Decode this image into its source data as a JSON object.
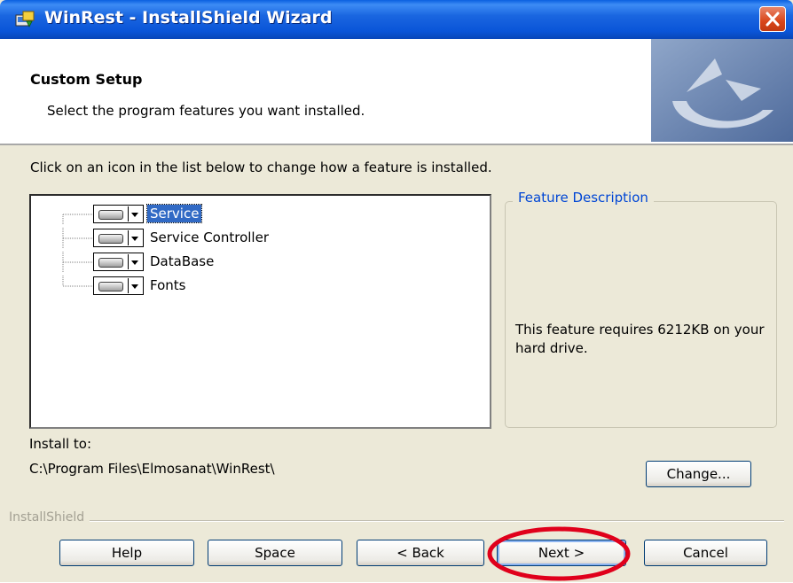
{
  "window": {
    "title": "WinRest - InstallShield Wizard"
  },
  "header": {
    "title": "Custom Setup",
    "subtitle": "Select the program features you want installed."
  },
  "instructions": "Click on an icon in the list below to change how a feature is installed.",
  "features": [
    {
      "label": "Service",
      "selected": true,
      "icon": "hard-drive-icon"
    },
    {
      "label": "Service Controller",
      "selected": false,
      "icon": "hard-drive-icon"
    },
    {
      "label": "DataBase",
      "selected": false,
      "icon": "hard-drive-icon"
    },
    {
      "label": "Fonts",
      "selected": false,
      "icon": "hard-drive-icon"
    }
  ],
  "description": {
    "legend": "Feature Description",
    "text": "This feature requires 6212KB on your hard drive."
  },
  "install": {
    "label": "Install to:",
    "path": "C:\\Program Files\\Elmosanat\\WinRest\\"
  },
  "brand": "InstallShield",
  "buttons": {
    "change": "Change...",
    "help": "Help",
    "space": "Space",
    "back": "< Back",
    "next": "Next >",
    "cancel": "Cancel"
  },
  "colors": {
    "title_bar": "#0a55d8",
    "selection": "#316ac5",
    "legend_text": "#0046d5",
    "annotation": "#e0001b"
  }
}
